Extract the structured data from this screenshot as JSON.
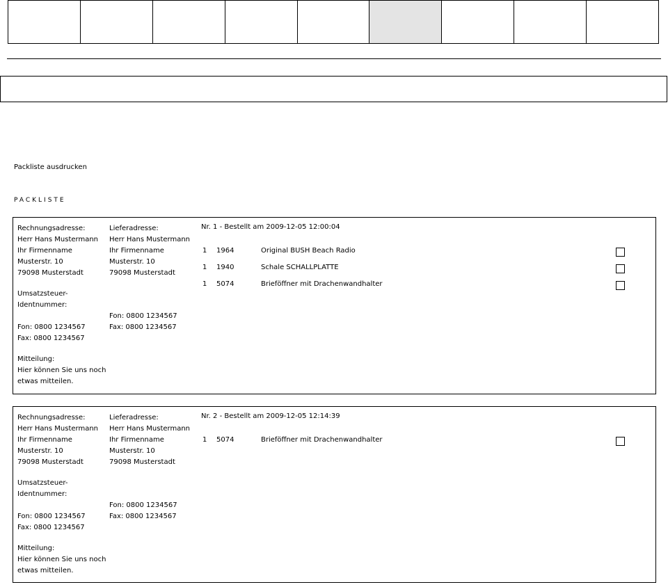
{
  "nav": {
    "cells": 9,
    "active_index": 5,
    "active_color": "#e4e4e4"
  },
  "actions": {
    "print_label": "Packliste ausdrucken"
  },
  "page_heading": "PACKLISTE",
  "orders": [
    {
      "billing": {
        "title": "Rechnungsadresse:",
        "name": "Herr Hans Mustermann",
        "company": "Ihr Firmenname",
        "street": "Musterstr. 10",
        "city": "79098 Musterstadt",
        "vat_line1": "Umsatzsteuer-",
        "vat_line2": "Identnummer:",
        "phone": "Fon: 0800 1234567",
        "fax": "Fax: 0800 1234567",
        "message_title": "Mitteilung:",
        "message_line1": "Hier können Sie uns noch",
        "message_line2": "etwas mitteilen."
      },
      "shipping": {
        "title": "Lieferadresse:",
        "name": "Herr Hans Mustermann",
        "company": "Ihr Firmenname",
        "street": "Musterstr. 10",
        "city": "79098 Musterstadt",
        "phone": "Fon: 0800 1234567",
        "fax": "Fax: 0800 1234567"
      },
      "header": "Nr. 1 - Bestellt am 2009-12-05 12:00:04",
      "items": [
        {
          "qty": "1",
          "artnr": "1964",
          "name": "Original BUSH Beach Radio"
        },
        {
          "qty": "1",
          "artnr": "1940",
          "name": "Schale SCHALLPLATTE"
        },
        {
          "qty": "1",
          "artnr": "5074",
          "name": "Brieföffner mit Drachenwandhalter"
        }
      ]
    },
    {
      "billing": {
        "title": "Rechnungsadresse:",
        "name": "Herr Hans Mustermann",
        "company": "Ihr Firmenname",
        "street": "Musterstr. 10",
        "city": "79098 Musterstadt",
        "vat_line1": "Umsatzsteuer-",
        "vat_line2": "Identnummer:",
        "phone": "Fon: 0800 1234567",
        "fax": "Fax: 0800 1234567",
        "message_title": "Mitteilung:",
        "message_line1": "Hier können Sie uns noch",
        "message_line2": "etwas mitteilen."
      },
      "shipping": {
        "title": "Lieferadresse:",
        "name": "Herr Hans Mustermann",
        "company": "Ihr Firmenname",
        "street": "Musterstr. 10",
        "city": "79098 Musterstadt",
        "phone": "Fon: 0800 1234567",
        "fax": "Fax: 0800 1234567"
      },
      "header": "Nr. 2 - Bestellt am 2009-12-05 12:14:39",
      "items": [
        {
          "qty": "1",
          "artnr": "5074",
          "name": "Brieföffner mit Drachenwandhalter"
        }
      ]
    }
  ]
}
